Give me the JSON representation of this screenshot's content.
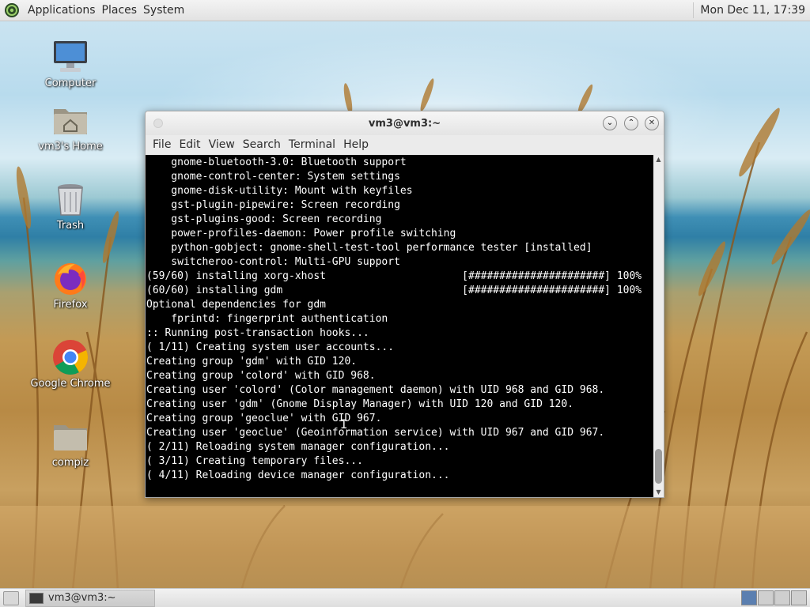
{
  "top_panel": {
    "menus": [
      "Applications",
      "Places",
      "System"
    ],
    "clock": "Mon Dec 11, 17:39"
  },
  "desktop_icons": [
    {
      "label": "Computer",
      "icon": "computer-icon"
    },
    {
      "label": "vm3's Home",
      "icon": "home-folder-icon"
    },
    {
      "label": "Trash",
      "icon": "trash-icon"
    },
    {
      "label": "Firefox",
      "icon": "firefox-icon"
    },
    {
      "label": "Google Chrome",
      "icon": "chrome-icon"
    },
    {
      "label": "compiz",
      "icon": "folder-icon"
    }
  ],
  "window": {
    "title": "vm3@vm3:~",
    "menu": [
      "File",
      "Edit",
      "View",
      "Search",
      "Terminal",
      "Help"
    ],
    "buttons": {
      "minimize": "⌄",
      "maximize": "⌃",
      "close": "✕"
    }
  },
  "terminal": {
    "lines": [
      "    gnome-bluetooth-3.0: Bluetooth support",
      "    gnome-control-center: System settings",
      "    gnome-disk-utility: Mount with keyfiles",
      "    gst-plugin-pipewire: Screen recording",
      "    gst-plugins-good: Screen recording",
      "    power-profiles-daemon: Power profile switching",
      "    python-gobject: gnome-shell-test-tool performance tester [installed]",
      "    switcheroo-control: Multi-GPU support",
      "(59/60) installing xorg-xhost                      [######################] 100%",
      "(60/60) installing gdm                             [######################] 100%",
      "Optional dependencies for gdm",
      "    fprintd: fingerprint authentication",
      ":: Running post-transaction hooks...",
      "( 1/11) Creating system user accounts...",
      "Creating group 'gdm' with GID 120.",
      "Creating group 'colord' with GID 968.",
      "Creating user 'colord' (Color management daemon) with UID 968 and GID 968.",
      "Creating user 'gdm' (Gnome Display Manager) with UID 120 and GID 120.",
      "Creating group 'geoclue' with GID 967.",
      "Creating user 'geoclue' (Geoinformation service) with UID 967 and GID 967.",
      "( 2/11) Reloading system manager configuration...",
      "( 3/11) Creating temporary files...",
      "( 4/11) Reloading device manager configuration..."
    ]
  },
  "taskbar": {
    "tasks": [
      {
        "label": "vm3@vm3:~",
        "icon": "terminal-icon"
      }
    ]
  }
}
